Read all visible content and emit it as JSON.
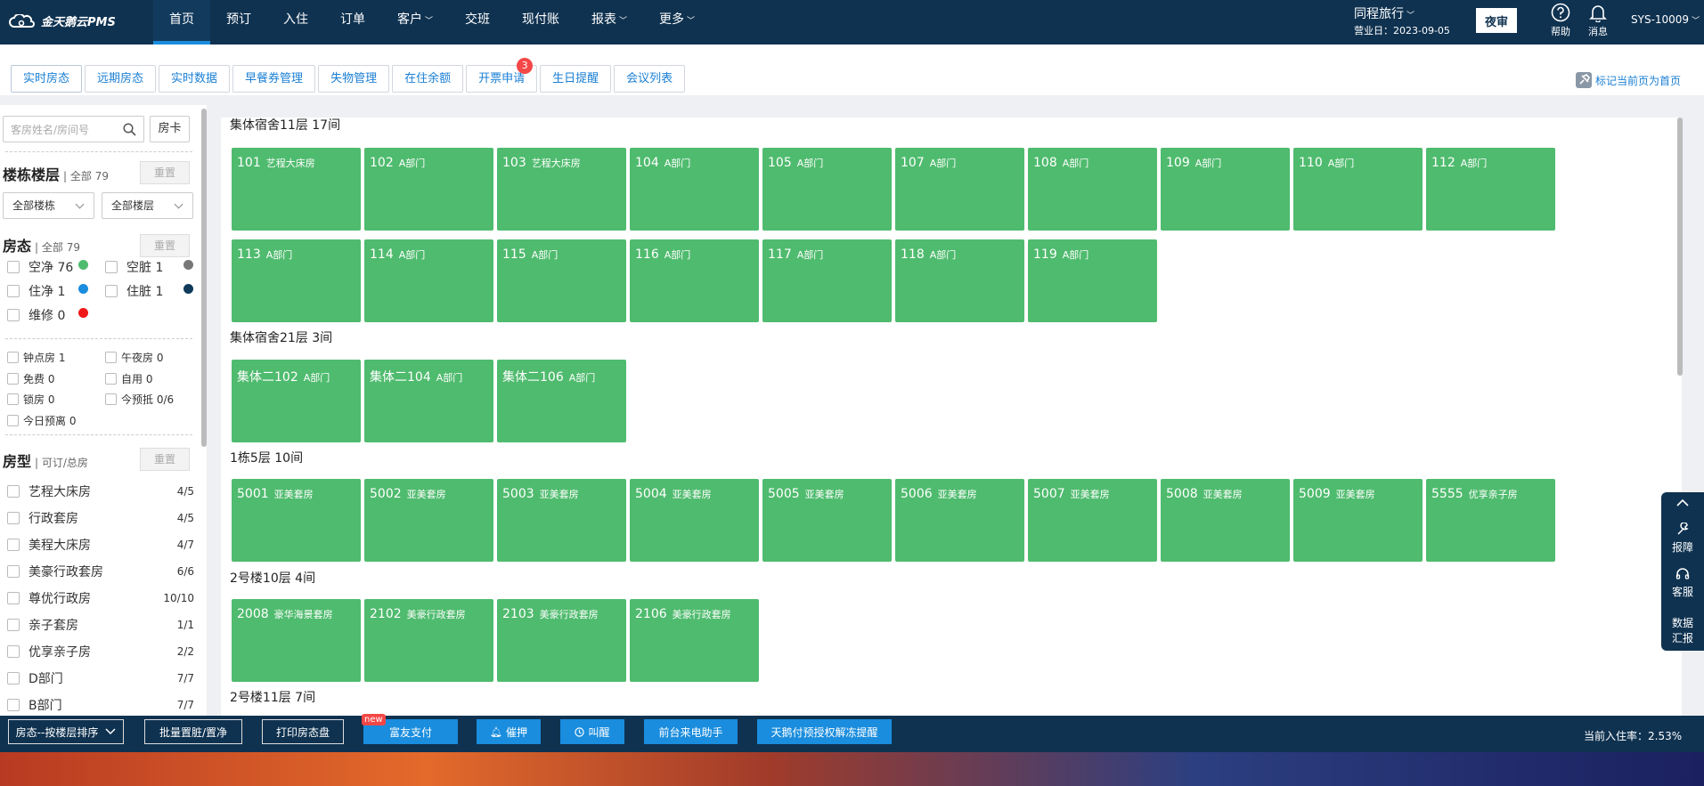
{
  "app": {
    "logo_text": "金天鹅云PMS"
  },
  "nav": {
    "items": [
      {
        "label": "首页",
        "active": true,
        "caret": false
      },
      {
        "label": "预订",
        "caret": false
      },
      {
        "label": "入住",
        "caret": false
      },
      {
        "label": "订单",
        "caret": false
      },
      {
        "label": "客户",
        "caret": true
      },
      {
        "label": "交班",
        "caret": false
      },
      {
        "label": "现付账",
        "caret": false
      },
      {
        "label": "报表",
        "caret": true
      },
      {
        "label": "更多",
        "caret": true
      }
    ]
  },
  "header": {
    "agency": "同程旅行",
    "business_date": "营业日：2023-09-05",
    "night_audit_label": "夜审",
    "help_label": "帮助",
    "message_label": "消息",
    "user": "SYS-10009"
  },
  "tabs": [
    {
      "label": "实时房态",
      "active": true
    },
    {
      "label": "远期房态"
    },
    {
      "label": "实时数据"
    },
    {
      "label": "早餐券管理"
    },
    {
      "label": "失物管理"
    },
    {
      "label": "在住余额"
    },
    {
      "label": "开票申请",
      "badge": "3"
    },
    {
      "label": "生日提醒"
    },
    {
      "label": "会议列表"
    }
  ],
  "mark_home_label": "标记当前页为首页",
  "sidebar": {
    "search_placeholder": "客房姓名/房间号",
    "room_card_label": "房卡",
    "building": {
      "title": "楼栋楼层",
      "count": "全部 79",
      "reset": "重置",
      "building_select": "全部楼栋",
      "floor_select": "全部楼层"
    },
    "status": {
      "title": "房态",
      "count": "全部 79",
      "reset": "重置",
      "items": [
        {
          "label": "空净 76",
          "color": "#4fbb6e"
        },
        {
          "label": "空脏 1",
          "color": "#777777"
        },
        {
          "label": "住净 1",
          "color": "#1a8dde"
        },
        {
          "label": "住脏 1",
          "color": "#0f3a5a"
        },
        {
          "label": "维修 0",
          "color": "#f01818"
        }
      ]
    },
    "flags": [
      {
        "label": "钟点房 1"
      },
      {
        "label": "午夜房 0"
      },
      {
        "label": "免费 0"
      },
      {
        "label": "自用 0"
      },
      {
        "label": "锁房 0"
      },
      {
        "label": "今预抵 0/6"
      },
      {
        "label": "今日预离 0"
      }
    ],
    "room_types": {
      "title": "房型",
      "subtitle": "可订/总房",
      "reset": "重置",
      "items": [
        {
          "name": "艺程大床房",
          "count": "4/5"
        },
        {
          "name": "行政套房",
          "count": "4/5"
        },
        {
          "name": "美程大床房",
          "count": "4/7"
        },
        {
          "name": "美豪行政套房",
          "count": "6/6"
        },
        {
          "name": "尊优行政房",
          "count": "10/10"
        },
        {
          "name": "亲子套房",
          "count": "1/1"
        },
        {
          "name": "优享亲子房",
          "count": "2/2"
        },
        {
          "name": "D部门",
          "count": "7/7"
        },
        {
          "name": "B部门",
          "count": "7/7"
        }
      ]
    }
  },
  "floors": [
    {
      "title": "集体宿舍11层 17间",
      "rooms": [
        {
          "num": "101",
          "type": "艺程大床房"
        },
        {
          "num": "102",
          "type": "A部门"
        },
        {
          "num": "103",
          "type": "艺程大床房"
        },
        {
          "num": "104",
          "type": "A部门"
        },
        {
          "num": "105",
          "type": "A部门"
        },
        {
          "num": "107",
          "type": "A部门"
        },
        {
          "num": "108",
          "type": "A部门"
        },
        {
          "num": "109",
          "type": "A部门"
        },
        {
          "num": "110",
          "type": "A部门"
        },
        {
          "num": "112",
          "type": "A部门"
        },
        {
          "num": "113",
          "type": "A部门"
        },
        {
          "num": "114",
          "type": "A部门"
        },
        {
          "num": "115",
          "type": "A部门"
        },
        {
          "num": "116",
          "type": "A部门"
        },
        {
          "num": "117",
          "type": "A部门"
        },
        {
          "num": "118",
          "type": "A部门"
        },
        {
          "num": "119",
          "type": "A部门"
        }
      ]
    },
    {
      "title": "集体宿舍21层 3间",
      "rooms": [
        {
          "num": "集体二102",
          "type": "A部门"
        },
        {
          "num": "集体二104",
          "type": "A部门"
        },
        {
          "num": "集体二106",
          "type": "A部门"
        }
      ]
    },
    {
      "title": "1栋5层 10间",
      "rooms": [
        {
          "num": "5001",
          "type": "亚美套房"
        },
        {
          "num": "5002",
          "type": "亚美套房"
        },
        {
          "num": "5003",
          "type": "亚美套房"
        },
        {
          "num": "5004",
          "type": "亚美套房"
        },
        {
          "num": "5005",
          "type": "亚美套房"
        },
        {
          "num": "5006",
          "type": "亚美套房"
        },
        {
          "num": "5007",
          "type": "亚美套房"
        },
        {
          "num": "5008",
          "type": "亚美套房"
        },
        {
          "num": "5009",
          "type": "亚美套房"
        },
        {
          "num": "5555",
          "type": "优享亲子房"
        }
      ]
    },
    {
      "title": "2号楼10层 4间",
      "rooms": [
        {
          "num": "2008",
          "type": "豪华海景套房"
        },
        {
          "num": "2102",
          "type": "美豪行政套房"
        },
        {
          "num": "2103",
          "type": "美豪行政套房"
        },
        {
          "num": "2106",
          "type": "美豪行政套房"
        }
      ]
    },
    {
      "title": "2号楼11层 7间",
      "rooms": []
    }
  ],
  "bottombar": {
    "sort_label": "房态--按楼层排序",
    "batch_label": "批量置脏/置净",
    "print_label": "打印房态盘",
    "fuyou_label": "富友支付",
    "new_badge": "new",
    "urge_label": "催押",
    "wake_label": "叫醒",
    "phone_label": "前台来电助手",
    "unfreeze_label": "天鹅付预授权解冻提醒",
    "occupancy": "当前入住率：2.53%"
  },
  "floatbar": {
    "repair": "报障",
    "service": "客服",
    "report_line1": "数据",
    "report_line2": "汇报"
  },
  "colors": {
    "room_vacant_clean": "#4fbb6e",
    "brand_dark": "#0f3250",
    "accent": "#1a8dde"
  }
}
